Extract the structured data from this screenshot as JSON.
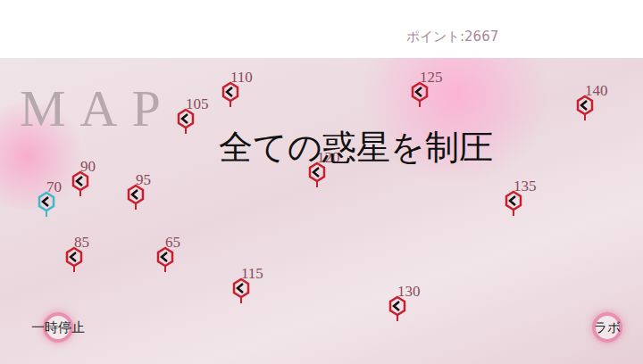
{
  "header": {
    "points": "ポイント:2667"
  },
  "map": {
    "title": "MAP",
    "banner": "全ての惑星を制圧",
    "planets": [
      {
        "label": "110",
        "color": "#c8202e"
      },
      {
        "label": "105",
        "color": "#c8202e"
      },
      {
        "label": "125",
        "color": "#c8202e"
      },
      {
        "label": "140",
        "color": "#c8202e"
      },
      {
        "label": "120",
        "color": "#c8202e"
      },
      {
        "label": "90",
        "color": "#c8202e"
      },
      {
        "label": "70",
        "color": "#3fb8c8"
      },
      {
        "label": "95",
        "color": "#c8202e"
      },
      {
        "label": "135",
        "color": "#c8202e"
      },
      {
        "label": "85",
        "color": "#c8202e"
      },
      {
        "label": "65",
        "color": "#c8202e"
      },
      {
        "label": "115",
        "color": "#c8202e"
      },
      {
        "label": "130",
        "color": "#c8202e"
      }
    ]
  },
  "buttons": [
    {
      "label": "一時停止"
    },
    {
      "label": "ラボ"
    }
  ]
}
